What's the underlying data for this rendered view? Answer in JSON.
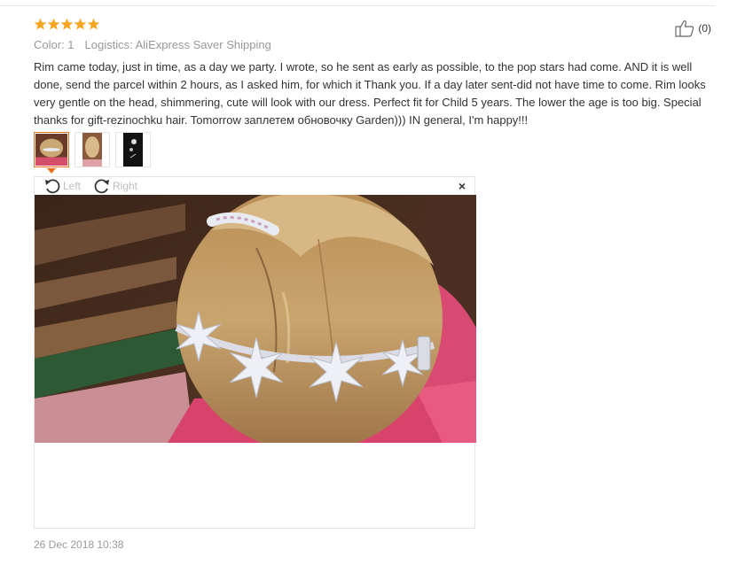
{
  "rating": {
    "stars": 5,
    "max": 5,
    "color": "#f5a623"
  },
  "helpful": {
    "icon": "thumbs-up-icon",
    "count_label": "(0)"
  },
  "meta": {
    "color_label": "Color: 1",
    "logistics_label": "Logistics: AliExpress Saver Shipping"
  },
  "review_text": "Rim came today, just in time, as a day we party. I wrote, so he sent as early as possible, to the pop stars had come. AND it is well done, send the parcel within 2 hours, as I asked him, for which it Thank you. If a day later sent-did not have time to come. Rim looks very gentle on the head, shimmering, cute will look with our dress. Perfect fit for Child 5 years. The lower the age is too big. Special thanks for gift-rezinochku hair. Tomorrow заплетем обновочку Garden))) IN general, I'm happy!!!",
  "thumbnails": [
    {
      "active": true
    },
    {
      "active": false
    },
    {
      "active": false
    }
  ],
  "viewer": {
    "rotate_left_label": "Left",
    "rotate_right_label": "Right",
    "close_label": "×"
  },
  "date": "26 Dec 2018 10:38",
  "colors": {
    "accent": "#e56e1f",
    "muted_text": "#999999",
    "star": "#f5a623"
  }
}
